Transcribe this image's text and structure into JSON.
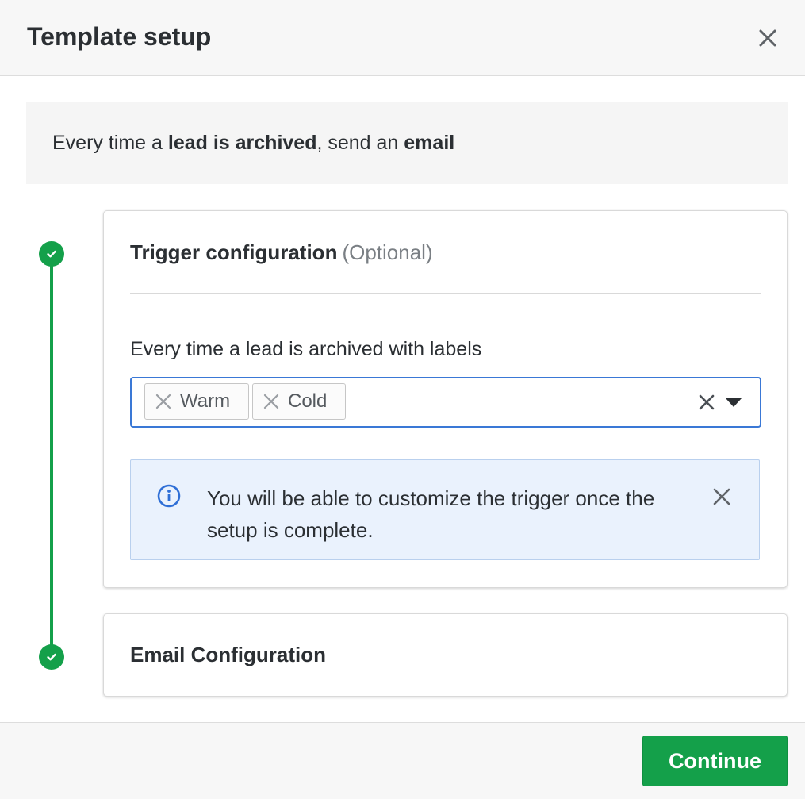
{
  "header": {
    "title": "Template setup",
    "close_icon": "close-icon"
  },
  "summary": {
    "prefix": "Every time a ",
    "trigger_bold": "lead is archived",
    "middle": ", send an ",
    "action_bold": "email"
  },
  "steps": [
    {
      "title": "Trigger configuration",
      "optional_label": "(Optional)",
      "status": "complete",
      "field_label": "Every time a lead is archived with labels",
      "selected_labels": [
        "Warm",
        "Cold"
      ],
      "info": {
        "text": "You will be able to customize the trigger once the setup is complete.",
        "icon": "info-icon"
      }
    },
    {
      "title": "Email Configuration",
      "status": "complete"
    }
  ],
  "footer": {
    "continue_label": "Continue"
  },
  "colors": {
    "accent_green": "#14a04a",
    "focus_blue": "#3a78d6",
    "info_bg": "#eaf2fd"
  }
}
